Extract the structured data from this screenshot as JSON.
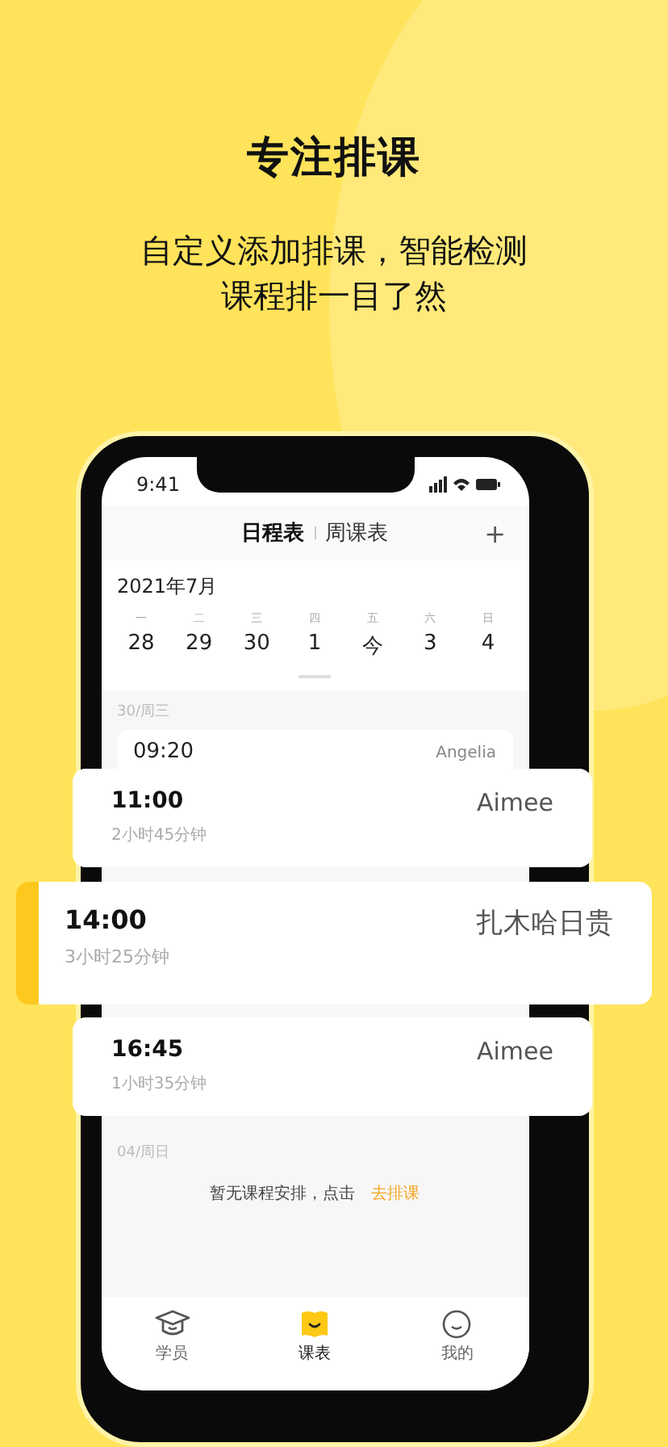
{
  "headline": "专注排课",
  "subtitle_lines": [
    "自定义添加排课，智能检测",
    "课程排一目了然"
  ],
  "phone": {
    "status_bar": {
      "time": "9:41"
    },
    "header": {
      "tabs": [
        {
          "label": "日程表",
          "selected": true
        },
        {
          "label": "周课表",
          "selected": false
        }
      ],
      "add_button": "+"
    },
    "calendar": {
      "month": "2021年7月",
      "days": [
        {
          "weekday": "一",
          "date": "28"
        },
        {
          "weekday": "二",
          "date": "29"
        },
        {
          "weekday": "三",
          "date": "30"
        },
        {
          "weekday": "四",
          "date": "1"
        },
        {
          "weekday": "五",
          "date": "今"
        },
        {
          "weekday": "六",
          "date": "3"
        },
        {
          "weekday": "日",
          "date": "4"
        }
      ]
    },
    "schedule": [
      {
        "date_label": "30/周三",
        "lessons": [
          {
            "time": "09:20",
            "student": "Angelia"
          }
        ]
      },
      {
        "date_label": "04/周日",
        "empty_text": "暂无课程安排，点击",
        "action_link": "去排课"
      }
    ],
    "tab_bar": [
      {
        "label": "学员",
        "kind": "cap",
        "selected": false
      },
      {
        "label": "课表",
        "kind": "book",
        "selected": true
      },
      {
        "label": "我的",
        "kind": "smile",
        "selected": false
      }
    ]
  },
  "floating_cards": [
    {
      "time": "11:00",
      "duration": "2小时45分钟",
      "student": "Aimee",
      "highlighted": false
    },
    {
      "time": "14:00",
      "duration": "3小时25分钟",
      "student": "扎木哈日贵",
      "highlighted": true
    },
    {
      "time": "16:45",
      "duration": "1小时35分钟",
      "student": "Aimee",
      "highlighted": false
    }
  ]
}
